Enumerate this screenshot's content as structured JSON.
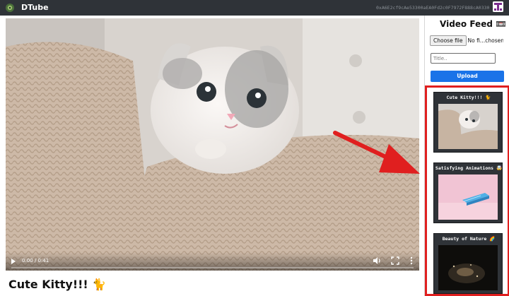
{
  "app": {
    "brand": "DTube",
    "account": "0xA6E2cf9cAe53300aEA0Fd2c0F7972F888cA0330b"
  },
  "player": {
    "time": "0:00 / 0:41",
    "progress": 0.0
  },
  "video_title": "Cute Kitty!!! 🐈",
  "sidebar": {
    "feed_title": "Video Feed 📼",
    "file_button": "Choose file",
    "file_name": "No fi…chosen",
    "title_placeholder": "Title..",
    "upload_label": "Upload",
    "feed": [
      {
        "title": "Cute Kitty!!! 🐈"
      },
      {
        "title": "Satisfying Animations 🤯"
      },
      {
        "title": "Beauty of Nature 🌈"
      }
    ]
  },
  "colors": {
    "navbar": "#2f3338",
    "upload": "#1a73e8",
    "highlight": "#e01f1f",
    "identicon": "#7b2d8e"
  },
  "icons": [
    "dtube-logo-icon",
    "identicon-avatar",
    "play-icon",
    "volume-icon",
    "fullscreen-icon",
    "more-options-icon",
    "red-arrow-annotation"
  ]
}
